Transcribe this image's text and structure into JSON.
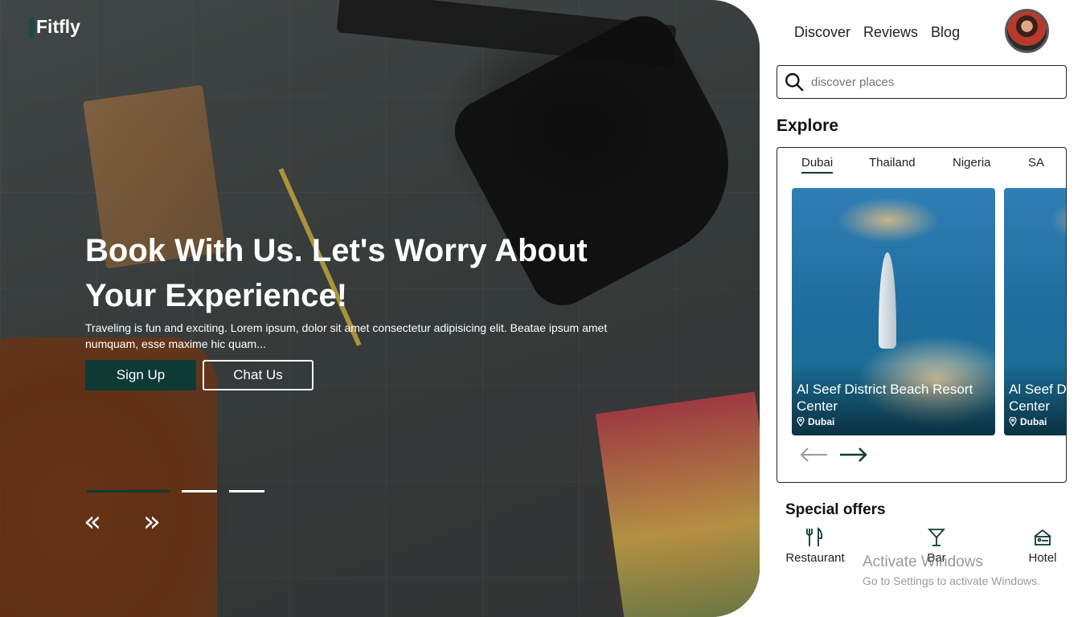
{
  "brand": {
    "name": "Fitfly"
  },
  "colors": {
    "accent": "#0e3a36",
    "dark_text": "#111111",
    "hero_text": "#ffffff"
  },
  "hero": {
    "title": "Book With Us. Let's Worry About Your Experience!",
    "description": "Traveling is fun and exciting. Lorem ipsum, dolor sit amet consectetur adipisicing elit. Beatae ipsum amet numquam, esse maxime hic quam...",
    "primary_button": "Sign Up",
    "secondary_button": "Chat Us",
    "slides": {
      "count": 3,
      "active": 1
    },
    "prev_arrow": "«",
    "next_arrow": "»"
  },
  "nav": {
    "items": [
      "Discover",
      "Reviews",
      "Blog"
    ]
  },
  "search": {
    "placeholder": "discover places",
    "value": ""
  },
  "explore": {
    "title": "Explore",
    "tabs": [
      "Dubai",
      "Thailand",
      "Nigeria",
      "SA"
    ],
    "active_tab": "Dubai",
    "cards": [
      {
        "title": "Al Seef District Beach Resort Center",
        "location": "Dubai"
      },
      {
        "title": "Al Seef District Beach Resort Center",
        "location": "Dubai"
      }
    ]
  },
  "offers": {
    "title": "Special offers",
    "items": [
      {
        "label": "Restaurant",
        "icon": "utensils-icon"
      },
      {
        "label": "Bar",
        "icon": "cocktail-icon"
      },
      {
        "label": "Hotel",
        "icon": "bed-icon"
      }
    ]
  },
  "watermark": {
    "line1": "Activate Windows",
    "line2": "Go to Settings to activate Windows."
  }
}
